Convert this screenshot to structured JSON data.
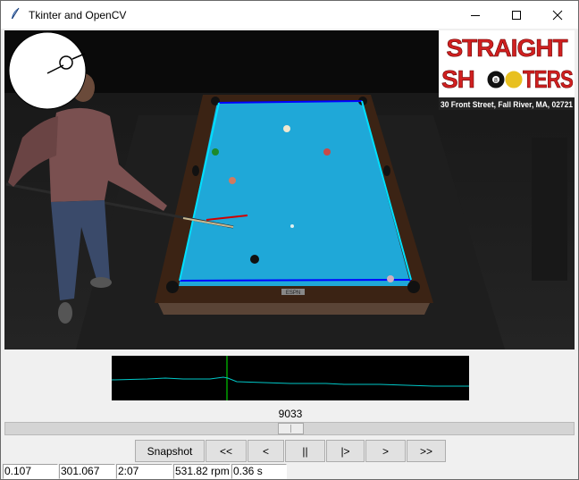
{
  "window": {
    "title": "Tkinter and OpenCV"
  },
  "video": {
    "sign_line1": "STRAIGHT",
    "sign_line2_a": "SH",
    "sign_line2_b": "TERS",
    "address": "30 Front Street, Fall River, MA, 02721",
    "ball_number": "8",
    "table_brand": "ESPN"
  },
  "frame_number": "9033",
  "scrubber": {
    "position_fraction": 0.503
  },
  "controls": [
    {
      "name": "snapshot-button",
      "label": "Snapshot"
    },
    {
      "name": "skip-back-button",
      "label": "<<"
    },
    {
      "name": "step-back-button",
      "label": "<"
    },
    {
      "name": "pause-button",
      "label": "||"
    },
    {
      "name": "play-button",
      "label": "|>"
    },
    {
      "name": "step-forward-button",
      "label": ">"
    },
    {
      "name": "skip-forward-button",
      "label": ">>"
    }
  ],
  "status": [
    "0.107",
    "301.067",
    "2:07",
    "531.82 rpm",
    "0.36 s"
  ],
  "colors": {
    "felt": "#1fa8d8",
    "rail": "#4a2a18",
    "cushion_line": "#0000ff",
    "side_line": "#00e0ff",
    "graph_line": "#00c8c8",
    "graph_marker": "#00a000",
    "cue_line": "#d00000"
  }
}
